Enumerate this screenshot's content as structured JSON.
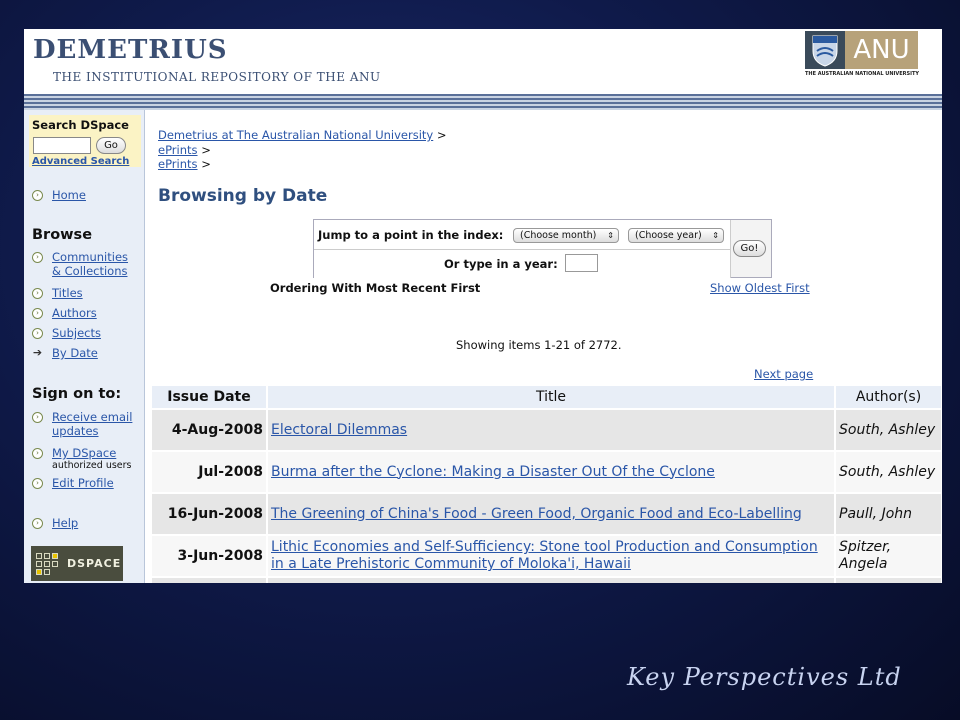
{
  "header": {
    "title": "DEMETRIUS",
    "subtitle": "THE INSTITUTIONAL REPOSITORY OF THE ANU",
    "logo_text": "ANU",
    "logo_caption": "THE AUSTRALIAN NATIONAL UNIVERSITY"
  },
  "sidebar": {
    "search_title": "Search DSpace",
    "go_label": "Go",
    "advanced_search": "Advanced Search",
    "home": "Home",
    "browse_heading": "Browse",
    "browse_items": [
      {
        "label": "Communities & Collections"
      },
      {
        "label": "Titles"
      },
      {
        "label": "Authors"
      },
      {
        "label": "Subjects"
      },
      {
        "label": "By Date"
      }
    ],
    "signon_heading": "Sign on to:",
    "signon_items": [
      {
        "label": "Receive email updates",
        "note": ""
      },
      {
        "label": "My DSpace",
        "note": "authorized users"
      },
      {
        "label": "Edit Profile",
        "note": ""
      }
    ],
    "help": "Help",
    "dspace_logo_text": "DSPACE"
  },
  "breadcrumbs": [
    {
      "label": "Demetrius at The Australian National University",
      "sep": ">"
    },
    {
      "label": "ePrints",
      "sep": ">"
    },
    {
      "label": "ePrints",
      "sep": ">"
    }
  ],
  "main": {
    "page_title": "Browsing by Date",
    "jump_label": "Jump to a point in the index:",
    "month_select": "(Choose month)",
    "year_select": "(Choose year)",
    "year_label": "Or type in a year:",
    "go_label": "Go!",
    "ordering": "Ordering With Most Recent First",
    "show_oldest": "Show Oldest First",
    "showing": "Showing items 1-21 of 2772.",
    "next_page": "Next page"
  },
  "table": {
    "headers": [
      "Issue Date",
      "Title",
      "Author(s)"
    ],
    "rows": [
      {
        "date": "4-Aug-2008",
        "title": "Electoral Dilemmas",
        "author": "South, Ashley"
      },
      {
        "date": "Jul-2008",
        "title": "Burma after the Cyclone: Making a Disaster Out Of the Cyclone",
        "author": "South, Ashley"
      },
      {
        "date": "16-Jun-2008",
        "title": "The Greening of China's Food - Green Food, Organic Food and Eco-Labelling",
        "author": "Paull, John"
      },
      {
        "date": "3-Jun-2008",
        "title": "Lithic Economies and Self-Sufficiency: Stone tool Production and Consumption in a Late Prehistoric Community of Moloka'i, Hawaii",
        "author": "Spitzer, Angela"
      }
    ]
  },
  "footer_brand": "Key Perspectives Ltd"
}
